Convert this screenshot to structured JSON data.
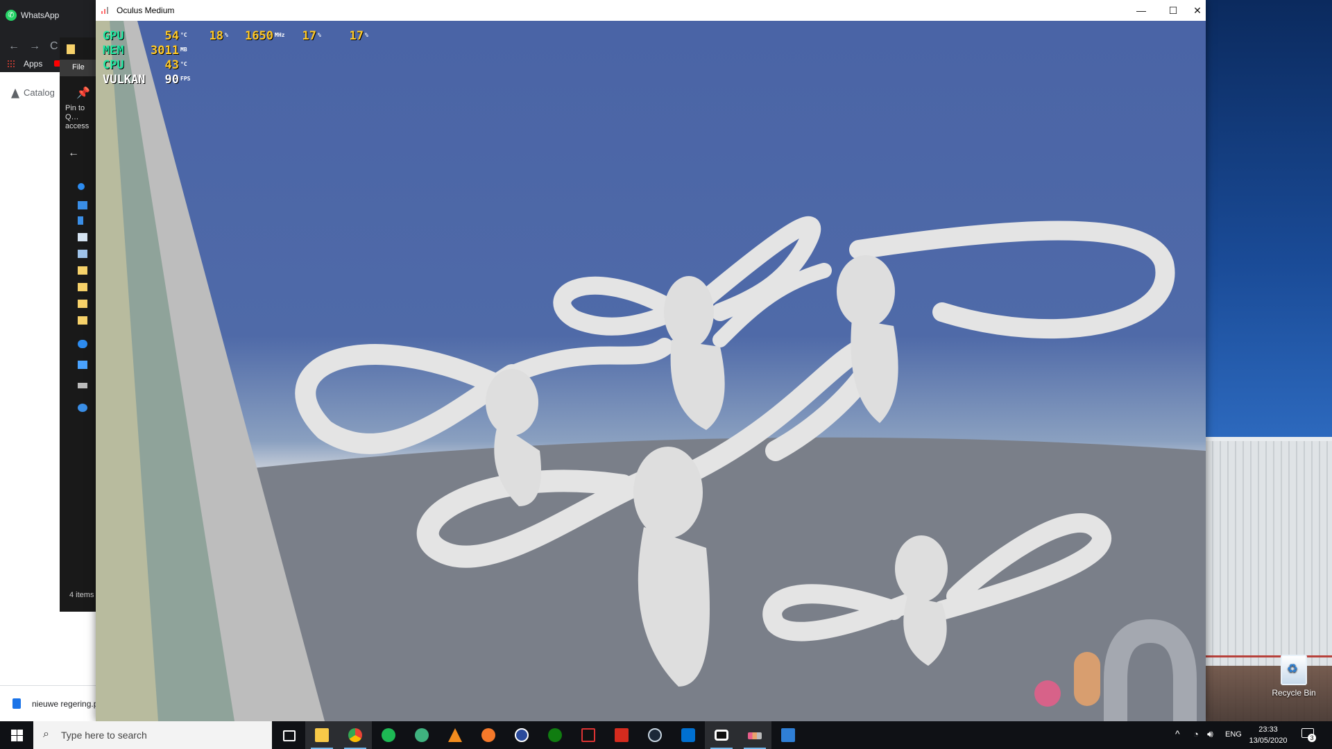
{
  "chrome": {
    "tab_title": "WhatsApp",
    "bookmarks_label": "Apps",
    "page_item": "Catalog"
  },
  "downloads": {
    "file_name": "nieuwe regering.p"
  },
  "explorer": {
    "file_tab": "File",
    "pin_label": "Pin to Q… access",
    "status": "4 items"
  },
  "medium": {
    "window_title": "Oculus Medium",
    "minimize": "—",
    "maximize": "☐",
    "close": "✕"
  },
  "perf": {
    "gpu": {
      "label": "GPU",
      "temp": "54",
      "temp_unit": "°C",
      "load": "18",
      "load_unit": "%",
      "clock": "1650",
      "clock_unit": "MHz",
      "a": "17",
      "a_unit": "%",
      "b": "17",
      "b_unit": "%"
    },
    "mem": {
      "label": "MEM",
      "value": "3011",
      "unit": "MB"
    },
    "cpu": {
      "label": "CPU",
      "value": "43",
      "unit": "°C"
    },
    "vulkan": {
      "label": "VULKAN",
      "value": "90",
      "unit": "FPS"
    }
  },
  "desktop": {
    "recycle_bin": "Recycle Bin"
  },
  "taskbar": {
    "search_placeholder": "Type here to search",
    "apps": [
      "task-view",
      "file-explorer",
      "chrome",
      "spotify",
      "app-green",
      "vlc",
      "blender",
      "cinema4d",
      "xbox",
      "ryzen-master",
      "adobe-flash",
      "steam",
      "ps-remote",
      "oculus",
      "oculus-medium",
      "photos"
    ],
    "language": "ENG",
    "time": "23:33",
    "date": "13/05/2020",
    "notifications": "3"
  },
  "colors": {
    "overlay_label": "#1fe6a0",
    "overlay_value": "#ffc928",
    "viewport_sky": "#4a64a6",
    "medium_logo_pink": "#e85d8a",
    "medium_logo_orange": "#e9a36b"
  }
}
